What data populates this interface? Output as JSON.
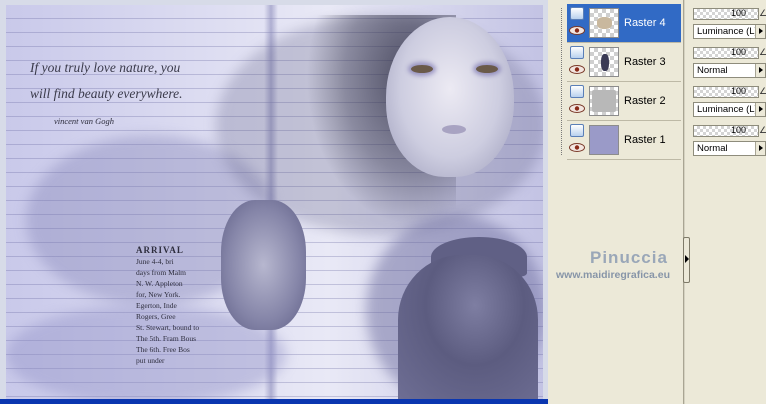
{
  "canvas": {
    "quote_line1": "If you truly love nature, you",
    "quote_line2": "will find beauty everywhere.",
    "signature": "vincent van Gogh",
    "newsprint": [
      "ARRIVAL",
      "June 4-4, bri",
      "days from Malm",
      "N. W. Appleton",
      "for, New York.",
      "Egerton, Inde",
      "Rogers, Gree",
      "St. Stewart, bound to",
      "The 5th. Fram Bous",
      "The 6th. Free Bos",
      "put under"
    ],
    "watermark_name": "Pinuccia",
    "watermark_url": "www.maidiregrafica.eu"
  },
  "layers": [
    {
      "name": "Raster 4",
      "selected": true,
      "opacity": "100",
      "blend_mode": "Luminance (L)"
    },
    {
      "name": "Raster 3",
      "selected": false,
      "opacity": "100",
      "blend_mode": "Normal"
    },
    {
      "name": "Raster 2",
      "selected": false,
      "opacity": "100",
      "blend_mode": "Luminance (L)"
    },
    {
      "name": "Raster 1",
      "selected": false,
      "opacity": "100",
      "blend_mode": "Normal"
    }
  ],
  "colors": {
    "selection": "#316ac5",
    "panel_bg": "#ece9d8",
    "canvas_lavender": "#c9c9ea",
    "taskbar_blue": "#0a36b0"
  },
  "icons": {
    "visibility": "eye-icon",
    "layer_type": "raster-layer-icon",
    "collapse": "chevron-right-icon"
  }
}
